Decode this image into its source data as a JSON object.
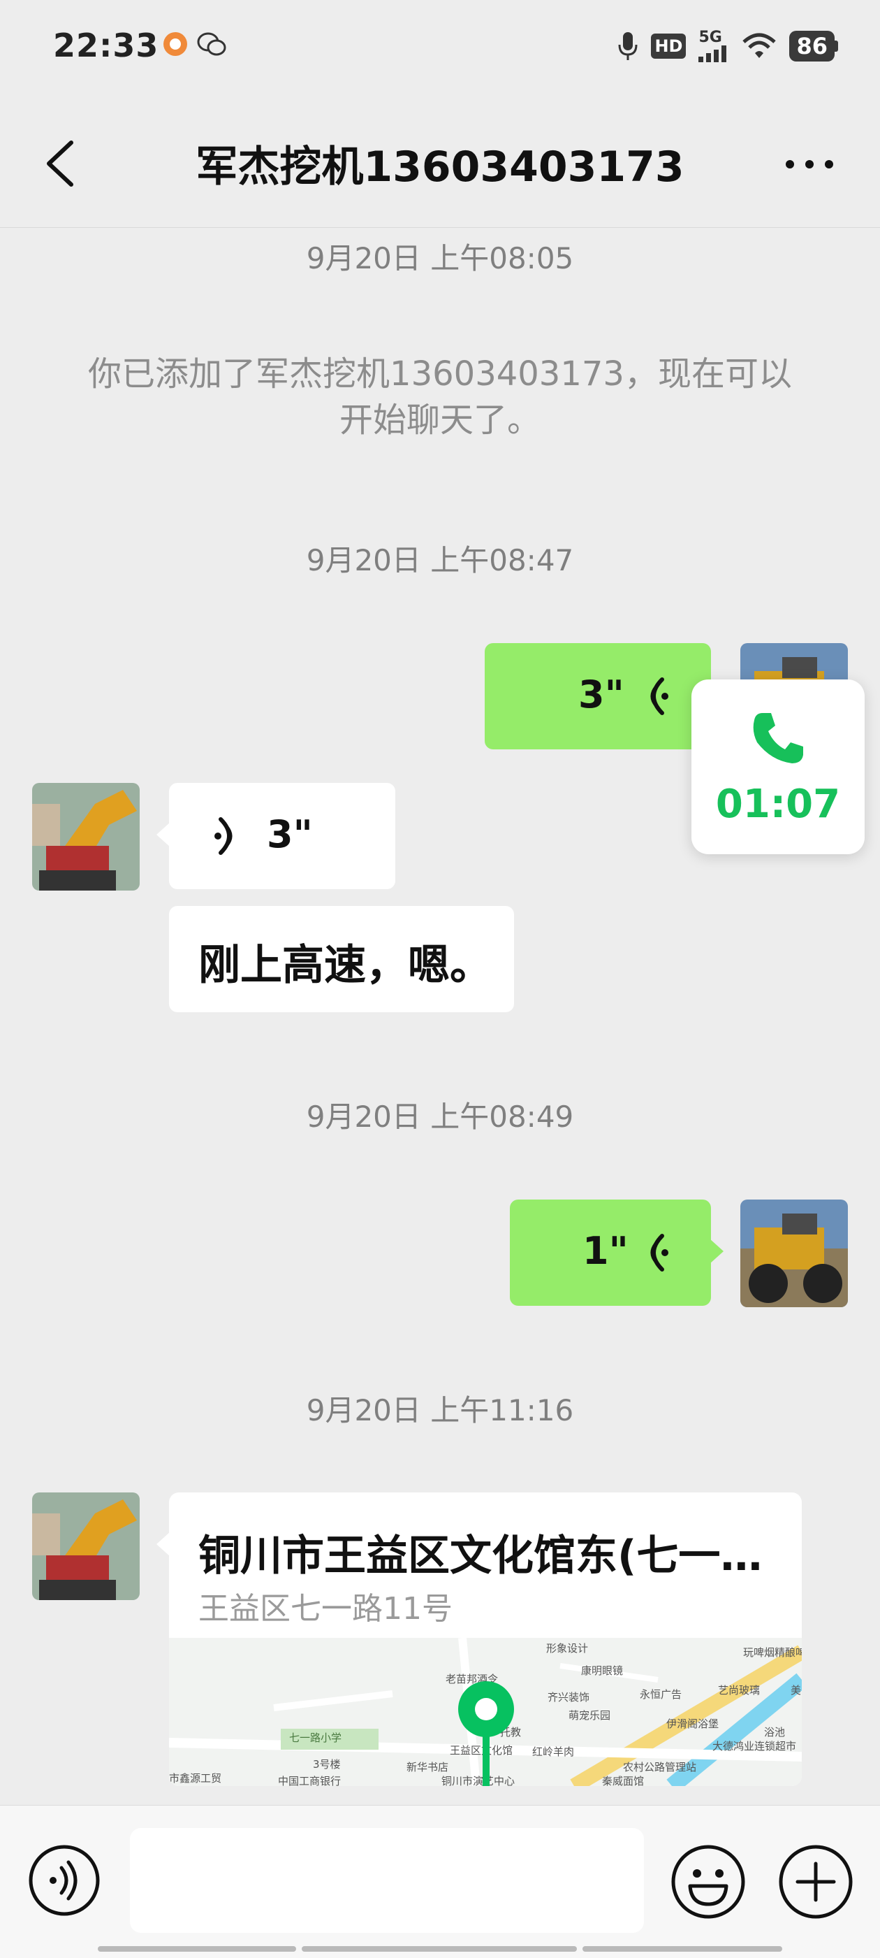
{
  "status_bar": {
    "time": "22:33",
    "network": "5G",
    "battery": "86",
    "hd": "HD",
    "icons": [
      "app-notification-icon",
      "wechat-icon",
      "mic-icon",
      "hd-icon",
      "signal-5g-icon",
      "wifi-icon",
      "battery-icon"
    ]
  },
  "nav": {
    "title": "军杰挖机13603403173",
    "back_icon": "chevron-left-icon",
    "more_icon": "more-dots-icon"
  },
  "messages": {
    "ts1": "9月20日 上午08:05",
    "system": "你已添加了军杰挖机13603403173，现在可以开始聊天了。",
    "ts2": "9月20日 上午08:47",
    "voice_out_1": "3\"",
    "voice_in_1": "3\"",
    "text_in_1": "刚上高速，嗯。",
    "ts3": "9月20日 上午08:49",
    "voice_out_2": "1\"",
    "ts4": "9月20日 上午11:16"
  },
  "call_overlay": {
    "duration": "01:07",
    "icon": "phone-icon"
  },
  "location": {
    "title": "铜川市王益区文化馆东(七一…",
    "address": "王益区七一路11号",
    "map_labels": [
      "形象设计",
      "玩啤烟精酿啤酒屋",
      "康明眼镜",
      "老苗邦酒令",
      "永恒广告",
      "艺尚玻璃",
      "齐兴装饰",
      "萌宠乐园",
      "伊滑阁浴堡",
      "七一路小学",
      "托教",
      "王益区文化馆",
      "红岭羊肉",
      "大德鸿业连锁超市",
      "浴池",
      "3号楼",
      "新华书店",
      "农村公路管理站",
      "市鑫源工贸",
      "中国工商银行",
      "铜川市演艺中心",
      "秦威面馆",
      "美"
    ]
  },
  "input_bar": {
    "placeholder": "",
    "icons": [
      "voice-toggle-icon",
      "emoji-icon",
      "plus-icon"
    ]
  },
  "colors": {
    "bubble_out": "#95ec69",
    "bubble_in": "#ffffff",
    "background": "#ededed",
    "call_green": "#17c05a",
    "map_pin": "#07c160"
  }
}
